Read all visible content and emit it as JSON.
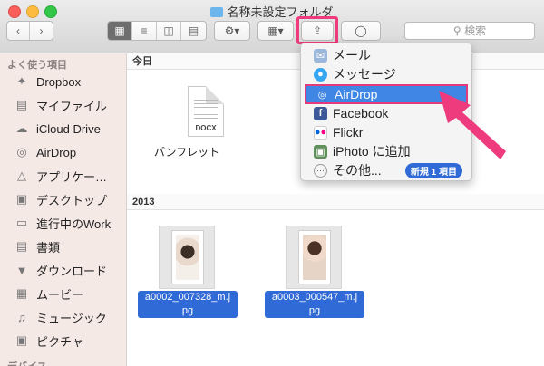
{
  "window": {
    "title": "名称未設定フォルダ"
  },
  "toolbar": {
    "search_placeholder": "検索"
  },
  "sidebar": {
    "heading": "よく使う項目",
    "items": [
      {
        "label": "Dropbox",
        "icon": "dropbox-icon"
      },
      {
        "label": "マイファイル",
        "icon": "all-files-icon"
      },
      {
        "label": "iCloud Drive",
        "icon": "cloud-icon"
      },
      {
        "label": "AirDrop",
        "icon": "airdrop-icon"
      },
      {
        "label": "アプリケー…",
        "icon": "applications-icon"
      },
      {
        "label": "デスクトップ",
        "icon": "desktop-icon"
      },
      {
        "label": "進行中のWork",
        "icon": "folder-icon"
      },
      {
        "label": "書類",
        "icon": "documents-icon"
      },
      {
        "label": "ダウンロード",
        "icon": "downloads-icon"
      },
      {
        "label": "ムービー",
        "icon": "movies-icon"
      },
      {
        "label": "ミュージック",
        "icon": "music-icon"
      },
      {
        "label": "ピクチャ",
        "icon": "pictures-icon"
      }
    ],
    "devices_heading": "デバイス"
  },
  "content": {
    "sections": [
      {
        "heading": "今日"
      },
      {
        "heading": "2013"
      }
    ],
    "files": {
      "docx": {
        "name": "パンフレット",
        "badge": "DOCX"
      },
      "photo1_line1": "a0002_007328_m.j",
      "photo1_line2": "pg",
      "photo2_line1": "a0003_000547_m.j",
      "photo2_line2": "pg"
    }
  },
  "share_menu": {
    "items": [
      {
        "label": "メール",
        "icon": "mail-icon"
      },
      {
        "label": "メッセージ",
        "icon": "messages-icon"
      },
      {
        "label": "AirDrop",
        "icon": "airdrop-icon",
        "highlighted": true
      },
      {
        "label": "Facebook",
        "icon": "facebook-icon"
      },
      {
        "label": "Flickr",
        "icon": "flickr-icon"
      },
      {
        "label": "iPhoto に追加",
        "icon": "iphoto-icon"
      },
      {
        "label": "その他...",
        "icon": "more-icon"
      }
    ],
    "new_badge": "新規 1 項目"
  },
  "colors": {
    "accent": "#ed3b7e",
    "selection": "#2f6ad6",
    "sidebar_bg": "#f5e9e6"
  }
}
